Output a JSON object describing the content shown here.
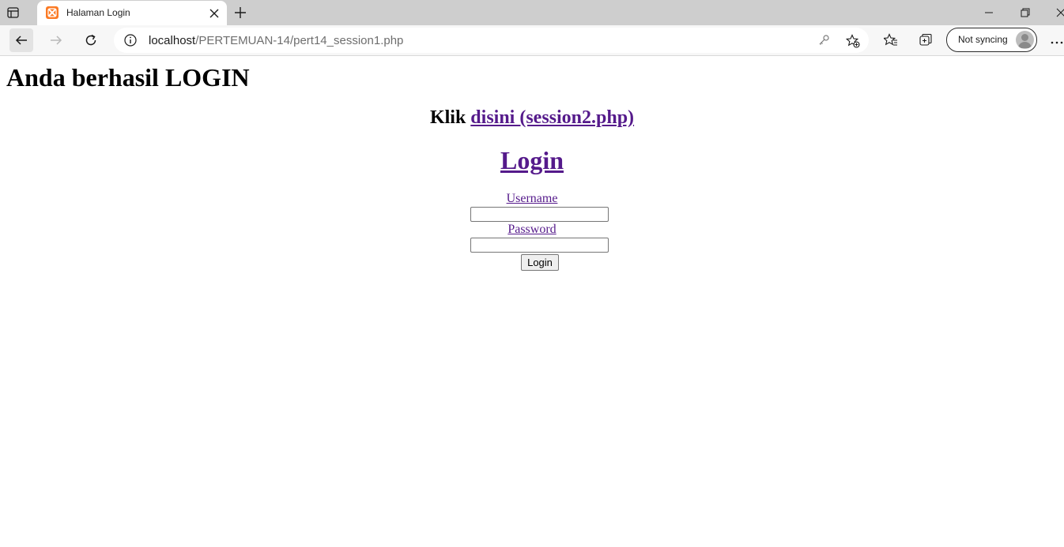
{
  "browser": {
    "tab_title": "Halaman Login",
    "url_host": "localhost",
    "url_path": "/PERTEMUAN-14/pert14_session1.php",
    "profile_label": "Not syncing"
  },
  "page": {
    "success_heading": "Anda berhasil LOGIN",
    "klik_text": "Klik ",
    "klik_link": "disini (session2.php)",
    "login_heading": "Login",
    "username_label": "Username",
    "password_label": "Password",
    "login_button": "Login"
  }
}
